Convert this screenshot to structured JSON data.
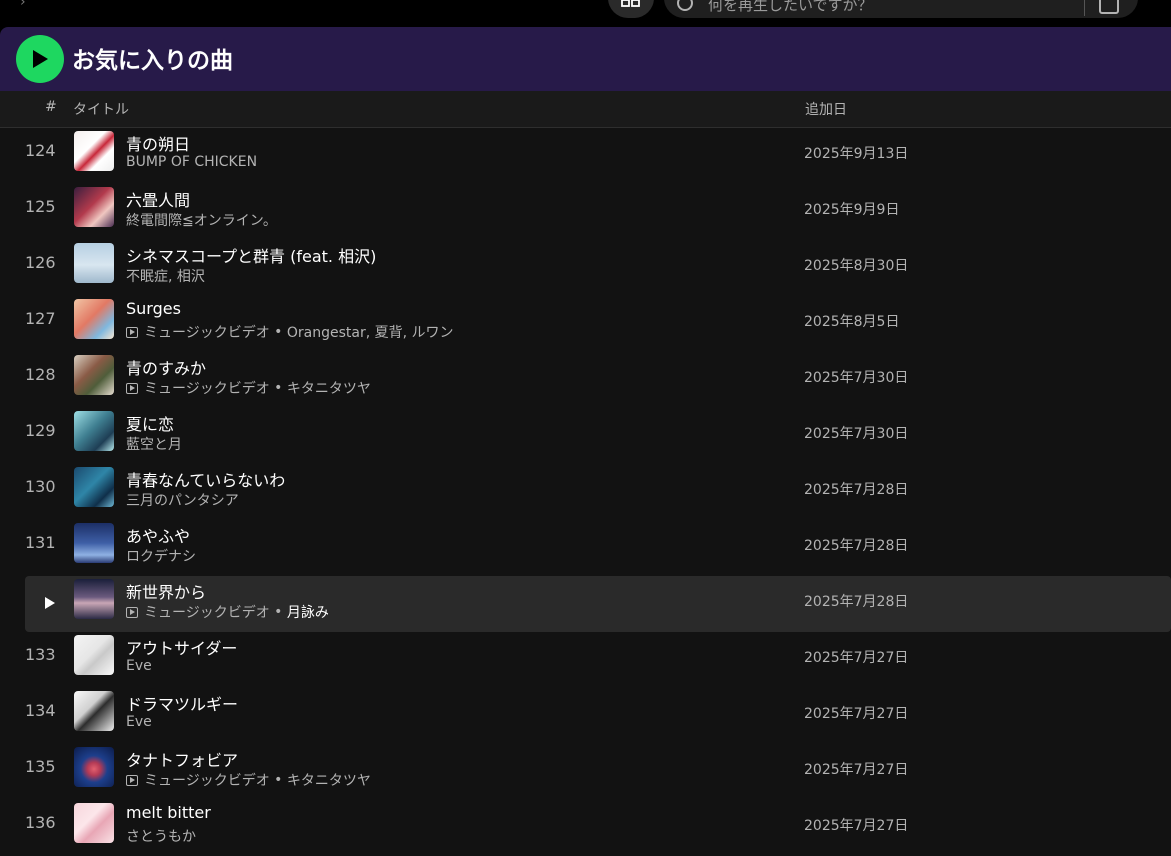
{
  "topbar": {
    "search_placeholder": "何を再生したいですか？"
  },
  "playlist": {
    "title": "お気に入りの曲"
  },
  "columns": {
    "number": "#",
    "title": "タイトル",
    "date_added": "追加日"
  },
  "colors": {
    "accent_green": "#1ed760",
    "header_bg": "#271a49",
    "background": "#121212",
    "active_row": "#2a2a2a"
  },
  "tracks": [
    {
      "num": "124",
      "title": "青の朔日",
      "music_video": false,
      "subtitle": "BUMP OF CHICKEN",
      "date": "2025年9月13日",
      "thumb": "linear-gradient(135deg,#f5f0ee 0%,#fff 40%,#c8283a 55%,#fff 70%,#eee 100%)"
    },
    {
      "num": "125",
      "title": "六畳人間",
      "music_video": false,
      "subtitle": "終電間際≦オンライン。",
      "date": "2025年9月9日",
      "thumb": "linear-gradient(135deg,#3a1e3e 0%,#b23a4c 45%,#f0c7c1 70%,#4a2d52 100%)"
    },
    {
      "num": "126",
      "title": "シネマスコープと群青 (feat. 相沢)",
      "music_video": false,
      "subtitle": "不眠症, 相沢",
      "date": "2025年8月30日",
      "thumb": "linear-gradient(180deg,#b6cfe2 0%,#d8e6f0 55%,#9fb8cc 100%)"
    },
    {
      "num": "127",
      "title": "Surges",
      "music_video": true,
      "mv_label": "ミュージックビデオ",
      "subtitle": "Orangestar, 夏背, ルワン",
      "date": "2025年8月5日",
      "thumb": "linear-gradient(135deg,#f1c6a6 0%,#e27964 45%,#7fb8df 75%,#f7e6d2 100%)"
    },
    {
      "num": "128",
      "title": "青のすみか",
      "music_video": true,
      "mv_label": "ミュージックビデオ",
      "subtitle": "キタニタツヤ",
      "date": "2025年7月30日",
      "thumb": "linear-gradient(135deg,#d9d0c2 0%,#8a5b46 40%,#4f5d3a 65%,#e6ddd0 100%)"
    },
    {
      "num": "129",
      "title": "夏に恋",
      "music_video": false,
      "subtitle": "藍空と月",
      "date": "2025年7月30日",
      "thumb": "linear-gradient(135deg,#9fe0e6 0%,#3f7f91 45%,#1e3e55 75%,#b8ecef 100%)"
    },
    {
      "num": "130",
      "title": "青春なんていらないわ",
      "music_video": false,
      "subtitle": "三月のパンタシア",
      "date": "2025年7月28日",
      "thumb": "linear-gradient(135deg,#1b4a6e 0%,#2f86a8 45%,#0f2f4a 75%,#6fb9d6 100%)"
    },
    {
      "num": "131",
      "title": "あやふや",
      "music_video": false,
      "subtitle": "ロクデナシ",
      "date": "2025年7月28日",
      "thumb": "linear-gradient(180deg,#1c2f66 0%,#3e5fa6 50%,#8fb1e3 80%,#2a3b74 100%)"
    },
    {
      "num": "132",
      "title": "新世界から",
      "music_video": true,
      "mv_label": "ミュージックビデオ",
      "subtitle": "月詠み",
      "date": "2025年7月28日",
      "active": true,
      "thumb": "linear-gradient(180deg,#1a1f3a 0%,#6a5a7e 45%,#c9a6b5 60%,#2b2a45 100%)"
    },
    {
      "num": "133",
      "title": "アウトサイダー",
      "music_video": false,
      "subtitle": "Eve",
      "date": "2025年7月27日",
      "thumb": "linear-gradient(135deg,#f4f4f4 0%,#e6e6e6 45%,#c9c9c9 60%,#fafafa 100%)"
    },
    {
      "num": "134",
      "title": "ドラマツルギー",
      "music_video": false,
      "subtitle": "Eve",
      "date": "2025年7月27日",
      "thumb": "linear-gradient(135deg,#fafafa 0%,#d0d0d0 40%,#2d2d2d 55%,#f0f0f0 100%)"
    },
    {
      "num": "135",
      "title": "タナトフォビア",
      "music_video": true,
      "mv_label": "ミュージックビデオ",
      "subtitle": "キタニタツヤ",
      "date": "2025年7月27日",
      "thumb": "radial-gradient(circle at 50% 55%,#e2606f 0%,#b43a55 22%,#1d3f8c 45%,#0c1c4a 100%)"
    },
    {
      "num": "136",
      "title": "melt bitter",
      "music_video": false,
      "subtitle": "さとうもか",
      "date": "2025年7月27日",
      "thumb": "linear-gradient(135deg,#f7d6dc 0%,#fce6ea 40%,#e8a6b5 60%,#f9e2e6 100%)"
    }
  ]
}
